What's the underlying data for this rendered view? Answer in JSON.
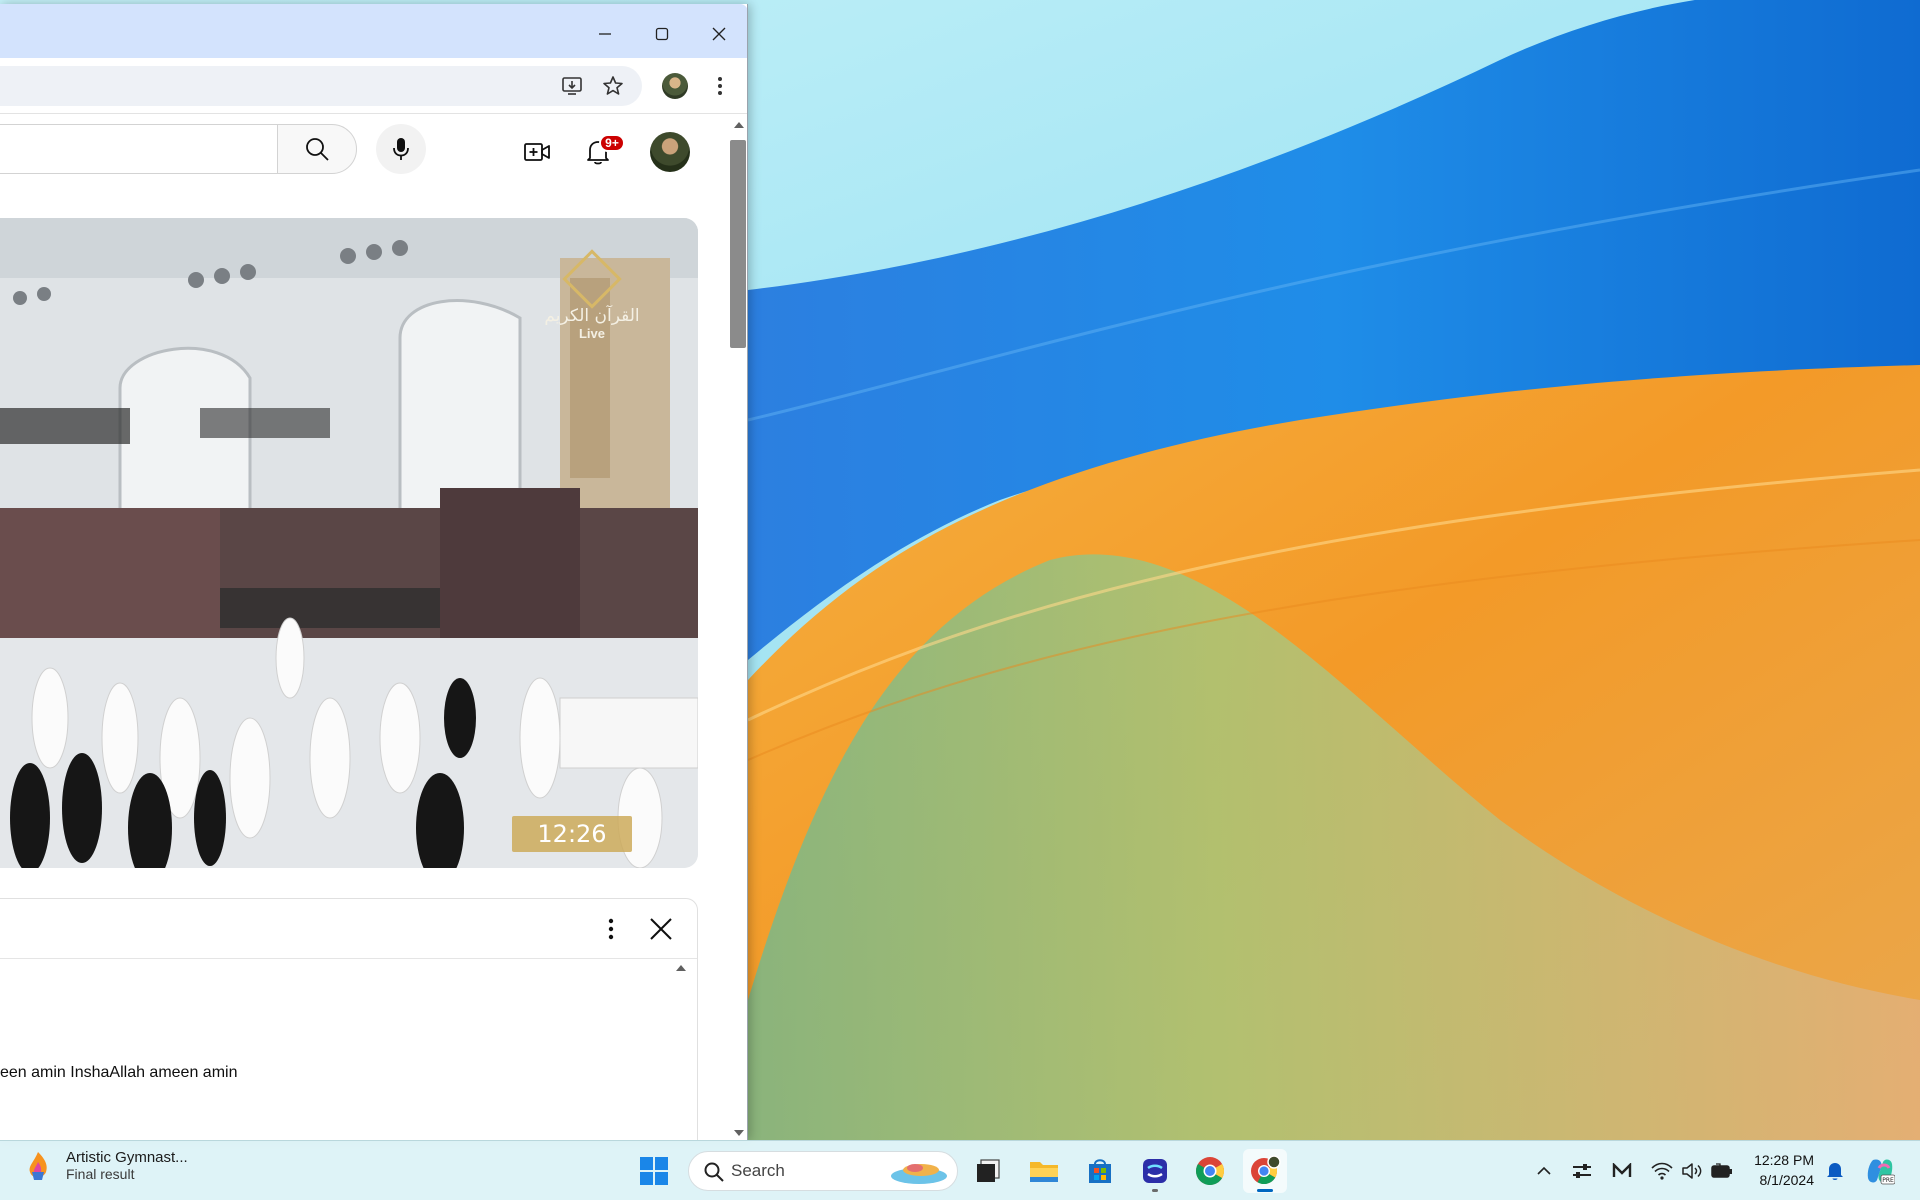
{
  "browser": {
    "window_controls": {
      "minimize": "minimize",
      "maximize": "maximize",
      "close": "close"
    }
  },
  "youtube": {
    "notifications_badge": "9+",
    "video": {
      "time_overlay": "12:26",
      "watermark_text": "القرآن الكريم",
      "watermark_live": "Live"
    },
    "chat": {
      "message": "een amin InshaAllah ameen amin"
    }
  },
  "taskbar": {
    "widget": {
      "title": "Artistic Gymnast...",
      "subtitle": "Final result"
    },
    "search_placeholder": "Search",
    "clock": {
      "time": "12:28 PM",
      "date": "8/1/2024"
    },
    "colors": {
      "accent": "#0067c0",
      "notification_badge": "#cc0000"
    }
  }
}
